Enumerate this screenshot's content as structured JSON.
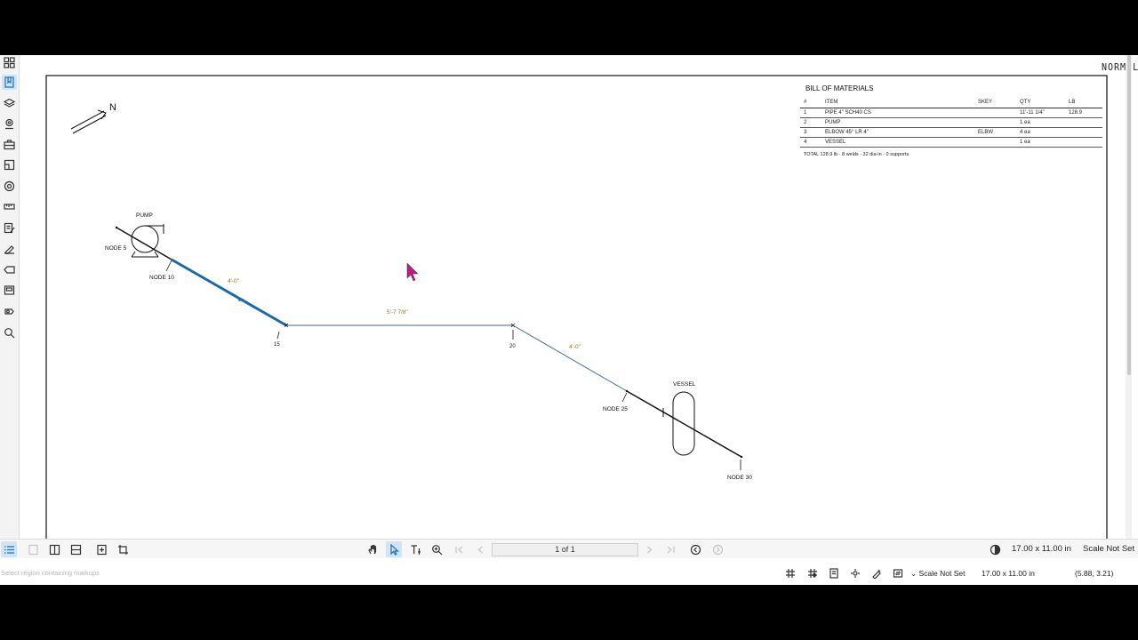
{
  "canvas": {
    "mode_label": "NORMAL",
    "north_label": "N"
  },
  "drawing": {
    "labels": {
      "pump": "PUMP",
      "node5": "NODE 5",
      "node10": "NODE 10",
      "node15": "15",
      "node20": "20",
      "node25": "NODE 25",
      "node30": "NODE 30",
      "vessel": "VESSEL"
    },
    "dimensions": {
      "seg1": "4'-0\"",
      "seg2": "5'-7 7/8\"",
      "seg3": "4'-0\""
    },
    "colors": {
      "selected_pipe": "#1a6aa6",
      "dimension_text": "#8a7a1a",
      "cursor": "#c0198a"
    }
  },
  "bom": {
    "title": "BILL OF MATERIALS",
    "headers": [
      "#",
      "ITEM",
      "SKEY",
      "QTY",
      "LB"
    ],
    "rows": [
      [
        "1",
        "PIPE 4\" SCH40 CS",
        "",
        "11'-11 1/4\"",
        "128.9"
      ],
      [
        "2",
        "PUMP",
        "",
        "1 ea",
        ""
      ],
      [
        "3",
        "ELBOW 45° LR 4\"",
        "ELBW",
        "4 ea",
        ""
      ],
      [
        "4",
        "VESSEL",
        "",
        "1 ea",
        ""
      ]
    ],
    "total": "TOTAL 128.9 lb · 8 welds · 32 dia-in · 0 supports"
  },
  "left_toolbar": {
    "icons": [
      "thumbnails-icon",
      "bookmarks-icon",
      "layers-icon",
      "locations-icon",
      "toolbox-icon",
      "markup-list-icon",
      "settings-icon",
      "measure-icon",
      "properties-icon",
      "signature-icon",
      "tag-icon",
      "stamp-icon",
      "link-icon",
      "search-icon"
    ]
  },
  "bottom_toolbar": {
    "page_indicator": "1 of 1",
    "page_size": "17.00 x 11.00 in",
    "scale": "Scale Not Set"
  },
  "status_bar": {
    "hint": "Select region containing markups",
    "scale": "Scale Not Set",
    "page_size": "17.00 x 11.00 in",
    "coordinates": "(5.88, 3.21)"
  }
}
